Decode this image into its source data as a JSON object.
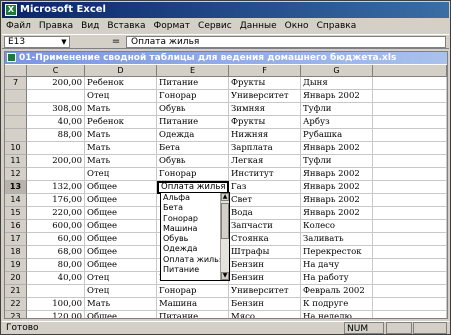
{
  "app": {
    "title": "Microsoft Excel"
  },
  "menu": [
    "Файл",
    "Правка",
    "Вид",
    "Вставка",
    "Формат",
    "Сервис",
    "Данные",
    "Окно",
    "Справка"
  ],
  "formula_bar": {
    "name_box": "E13",
    "equals": "=",
    "formula": "Оплата жилья"
  },
  "workbook": {
    "title": "01-Применение сводной таблицы для ведения домашнего бюджета.xls"
  },
  "columns": [
    "C",
    "D",
    "E",
    "F",
    "G"
  ],
  "rows": [
    {
      "num": "7",
      "c": "200,00",
      "d": "Ребенок",
      "e": "Питание",
      "f": "Фрукты",
      "g": "Дыня"
    },
    {
      "num": "",
      "c": "",
      "d": "Отец",
      "e": "Гонорар",
      "f": "Университет",
      "g": "Январь 2002"
    },
    {
      "num": "",
      "c": "308,00",
      "d": "Мать",
      "e": "Обувь",
      "f": "Зимняя",
      "g": "Туфли"
    },
    {
      "num": "",
      "c": "40,00",
      "d": "Ребенок",
      "e": "Питание",
      "f": "Фрукты",
      "g": "Арбуз"
    },
    {
      "num": "",
      "c": "88,00",
      "d": "Мать",
      "e": "Одежда",
      "f": "Нижняя",
      "g": "Рубашка"
    },
    {
      "num": "10",
      "c": "",
      "d": "Мать",
      "e": "Бета",
      "f": "Зарплата",
      "g": "Январь 2002"
    },
    {
      "num": "11",
      "c": "200,00",
      "d": "Мать",
      "e": "Обувь",
      "f": "Легкая",
      "g": "Туфли"
    },
    {
      "num": "12",
      "c": "",
      "d": "Отец",
      "e": "Гонорар",
      "f": "Институт",
      "g": "Январь 2002"
    },
    {
      "num": "13",
      "c": "132,00",
      "d": "Общее",
      "e": "Оплата жилья",
      "f": "Газ",
      "g": "Январь 2002"
    },
    {
      "num": "14",
      "c": "176,00",
      "d": "Общее",
      "e": "",
      "f": "Свет",
      "g": "Январь 2002"
    },
    {
      "num": "15",
      "c": "220,00",
      "d": "Общее",
      "e": "",
      "f": "Вода",
      "g": "Январь 2002"
    },
    {
      "num": "16",
      "c": "600,00",
      "d": "Общее",
      "e": "",
      "f": "Запчасти",
      "g": "Колесо"
    },
    {
      "num": "17",
      "c": "60,00",
      "d": "Общее",
      "e": "",
      "f": "Стоянка",
      "g": "Заливать"
    },
    {
      "num": "18",
      "c": "68,00",
      "d": "Общее",
      "e": "",
      "f": "Штрафы",
      "g": "Перекресток"
    },
    {
      "num": "19",
      "c": "80,00",
      "d": "Общее",
      "e": "",
      "f": "Бензин",
      "g": "На дачу"
    },
    {
      "num": "20",
      "c": "40,00",
      "d": "Отец",
      "e": "Машина",
      "f": "Бензин",
      "g": "На работу"
    },
    {
      "num": "21",
      "c": "",
      "d": "Отец",
      "e": "Гонорар",
      "f": "Университет",
      "g": "Февраль 2002"
    },
    {
      "num": "22",
      "c": "100,00",
      "d": "Мать",
      "e": "Машина",
      "f": "Бензин",
      "g": "К подруге"
    },
    {
      "num": "23",
      "c": "120,00",
      "d": "Общее",
      "e": "Питание",
      "f": "Мясо",
      "g": "На неделю"
    }
  ],
  "dropdown": {
    "options": [
      "Альфа",
      "Бета",
      "Гонорар",
      "Машина",
      "Обувь",
      "Одежда",
      "Оплата жилья",
      "Питание"
    ]
  },
  "status": {
    "left": "Готово",
    "num": "NUM"
  }
}
